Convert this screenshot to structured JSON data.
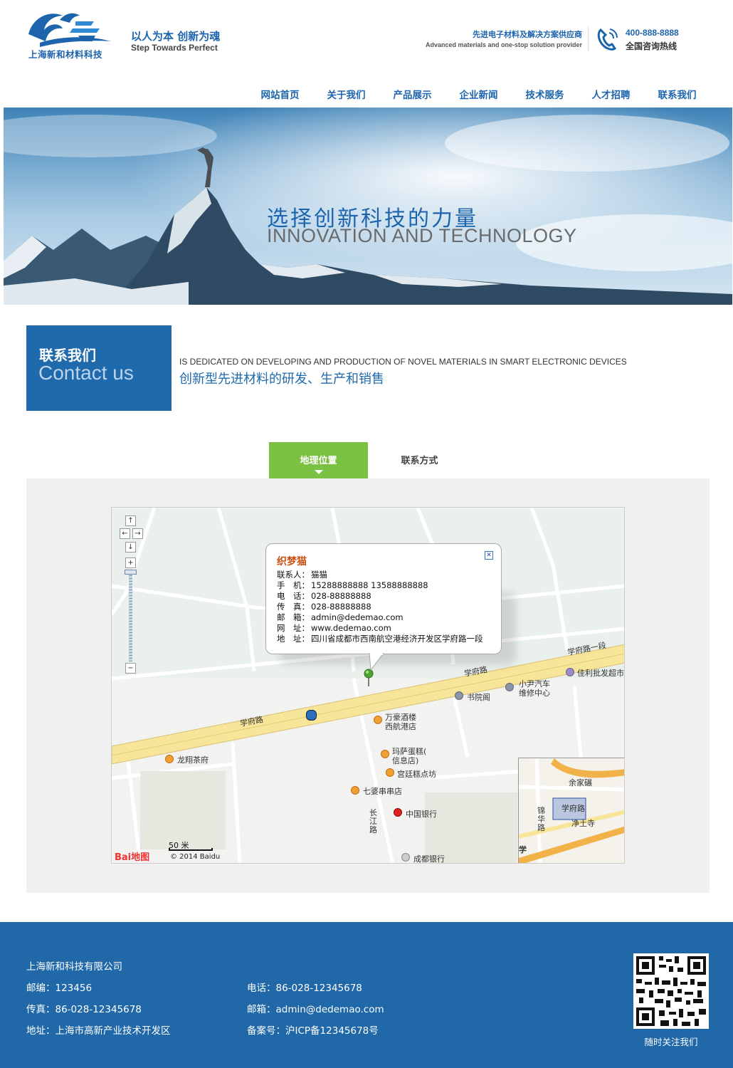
{
  "header": {
    "logo_name": "上海新和材料科技",
    "slogan_cn": "以人为本 创新为魂",
    "slogan_en": "Step Towards Perfect",
    "supplier_cn": "先进电子材料及解决方案供应商",
    "supplier_en": "Advanced materials and one-stop solution provider",
    "hotline": "400-888-8888",
    "hotline_label": "全国咨询热线"
  },
  "nav": [
    "网站首页",
    "关于我们",
    "产品展示",
    "企业新闻",
    "技术服务",
    "人才招聘",
    "联系我们"
  ],
  "banner": {
    "title_cn": "选择创新科技的力量",
    "title_en": "INNOVATION AND TECHNOLOGY"
  },
  "section": {
    "title_cn": "联系我们",
    "title_en": "Contact us",
    "intro_en": "IS DEDICATED ON DEVELOPING AND PRODUCTION OF NOVEL MATERIALS IN SMART ELECTRONIC DEVICES",
    "intro_cn": "创新型先进材料的研发、生产和销售"
  },
  "tabs": {
    "active": "地理位置",
    "other": "联系方式"
  },
  "map": {
    "zoom_in": "+",
    "zoom_out": "−",
    "info": {
      "title": "织梦猫",
      "rows": [
        {
          "k": "联系人：",
          "v": "猫猫"
        },
        {
          "k": "手　机：",
          "v": "15288888888  13588888888"
        },
        {
          "k": "电　话：",
          "v": "028-88888888"
        },
        {
          "k": "传　真：",
          "v": "028-88888888"
        },
        {
          "k": "邮　箱：",
          "v": "admin@dedemao.com"
        },
        {
          "k": "网　址：",
          "v": "www.dedemao.com"
        },
        {
          "k": "地　址：",
          "v": "四川省成都市西南航空港经济开发区学府路一段"
        }
      ]
    },
    "labels": {
      "road1": "学府路一段",
      "road2": "学府路",
      "road3": "学府路",
      "road4": "长江路",
      "poi1": "佳利批发超市",
      "poi2": "小尹汽车",
      "poi2b": "维修中心",
      "poi3": "书院阁",
      "poi4": "万豪酒楼",
      "poi4b": "西航港店",
      "poi5": "玛萨蛋糕(",
      "poi5b": "信息店)",
      "poi6": "宫廷糕点坊",
      "poi7": "七婆串串店",
      "poi8": "中国银行",
      "poi9": "成都银行",
      "poi10": "龙翔茶府",
      "mini1": "余家碾",
      "mini2": "学府路",
      "mini3": "锦华路",
      "mini4": "净土寺",
      "mini5": "学"
    },
    "scale": "50 米",
    "brand": "Bai地图",
    "copyright": "© 2014 Baidu"
  },
  "footer": {
    "company": "上海新和科技有限公司",
    "postcode": "邮编：123456",
    "fax": "传真：86-028-12345678",
    "address": "地址：上海市高新产业技术开发区",
    "phone": "电话：86-028-12345678",
    "email": "邮箱：admin@dedemao.com",
    "icp": "备案号：沪ICP备12345678号",
    "qr_label": "随时关注我们"
  },
  "colors": {
    "brand_blue": "#1f6aad",
    "tab_green": "#7ac142"
  }
}
